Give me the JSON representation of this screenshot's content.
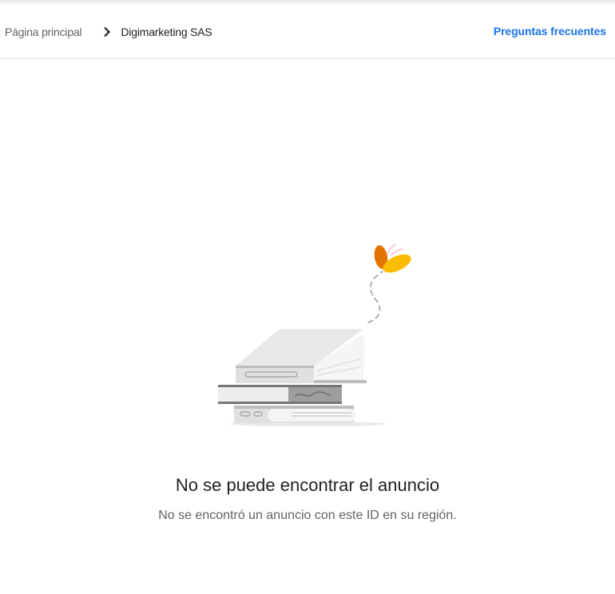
{
  "breadcrumb": {
    "home_label": "Página principal",
    "current_label": "Digimarketing SAS"
  },
  "header": {
    "faq_label": "Preguntas frecuentes"
  },
  "empty_state": {
    "title": "No se puede encontrar el anuncio",
    "message": "No se encontró un anuncio con este ID en su región.",
    "illustration": "books-with-butterfly-illustration"
  },
  "colors": {
    "link": "#1a73e8",
    "text_primary": "#202124",
    "text_secondary": "#5f6368",
    "butterfly_orange": "#e37400",
    "butterfly_yellow": "#fbbc04"
  },
  "icons": {
    "breadcrumb_separator": "chevron-right-icon"
  }
}
